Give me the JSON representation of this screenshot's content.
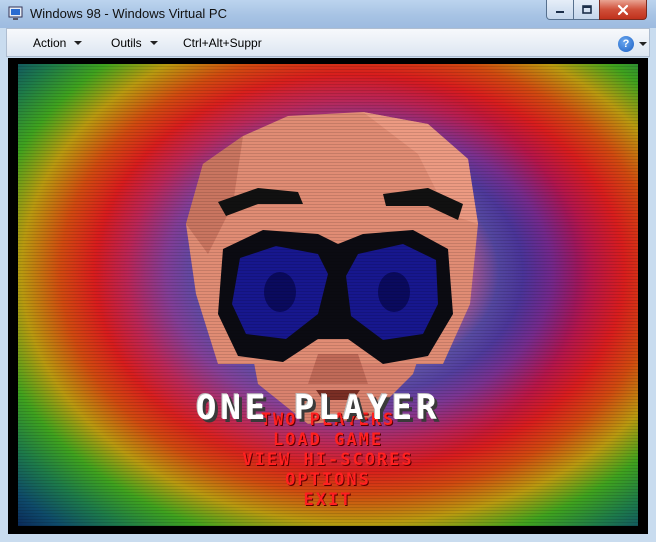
{
  "window": {
    "title": "Windows 98 - Windows Virtual PC",
    "controls": [
      "minimize-icon",
      "maximize-icon",
      "close-icon"
    ]
  },
  "menubar": {
    "action_label": "Action",
    "outils_label": "Outils",
    "ctrl_alt_label": "Ctrl+Alt+Suppr",
    "help_icon": "question-mark"
  },
  "game": {
    "colors": {
      "selected_option": "#ffffff",
      "option": "#ff2020",
      "skin": "#e08c74",
      "mask": "#0b0b12",
      "lens": "#1a1a9a"
    },
    "menu": {
      "selected": "ONE PLAYER",
      "options": [
        "TWO PLAYERS",
        "LOAD GAME",
        "VIEW HI-SCORES",
        "OPTIONS",
        "EXIT"
      ]
    }
  }
}
